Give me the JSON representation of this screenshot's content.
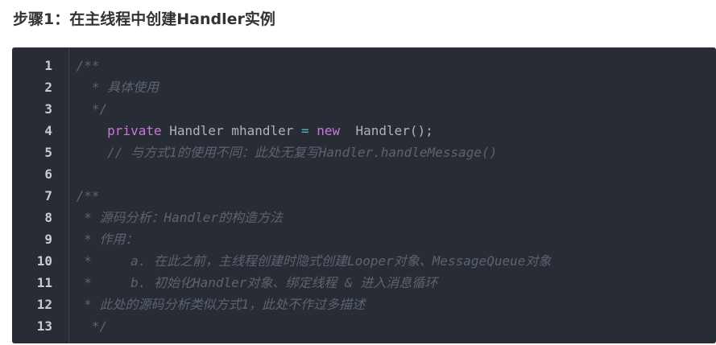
{
  "header": {
    "title": "步骤1：在主线程中创建Handler实例"
  },
  "code": {
    "line_numbers": [
      "1",
      "2",
      "3",
      "4",
      "5",
      "6",
      "7",
      "8",
      "9",
      "10",
      "11",
      "12",
      "13"
    ],
    "lines": [
      {
        "kind": "comment",
        "text": " /**"
      },
      {
        "kind": "comment",
        "text": "   * 具体使用"
      },
      {
        "kind": "comment",
        "text": "   */"
      },
      {
        "kind": "code",
        "indent": "     ",
        "kw1": "private",
        "t1": " Handler mhandler ",
        "op": "=",
        "sp": " ",
        "kw2": "new",
        "t2": "  Handler();"
      },
      {
        "kind": "comment",
        "text": "     // 与方式1的使用不同：此处无复写Handler.handleMessage()"
      },
      {
        "kind": "empty",
        "text": ""
      },
      {
        "kind": "comment",
        "text": " /**"
      },
      {
        "kind": "comment",
        "text": "  * 源码分析：Handler的构造方法"
      },
      {
        "kind": "comment",
        "text": "  * 作用："
      },
      {
        "kind": "comment",
        "text": "  *     a. 在此之前，主线程创建时隐式创建Looper对象、MessageQueue对象"
      },
      {
        "kind": "comment",
        "text": "  *     b. 初始化Handler对象、绑定线程 & 进入消息循环"
      },
      {
        "kind": "comment",
        "text": "  * 此处的源码分析类似方式1，此处不作过多描述"
      },
      {
        "kind": "comment",
        "text": "   */"
      }
    ]
  },
  "colors": {
    "background": "#282c34",
    "comment": "#5c6370",
    "keyword": "#c678dd",
    "operator": "#56b6c2",
    "text": "#abb2bf",
    "line_number": "#c8ccd4"
  }
}
